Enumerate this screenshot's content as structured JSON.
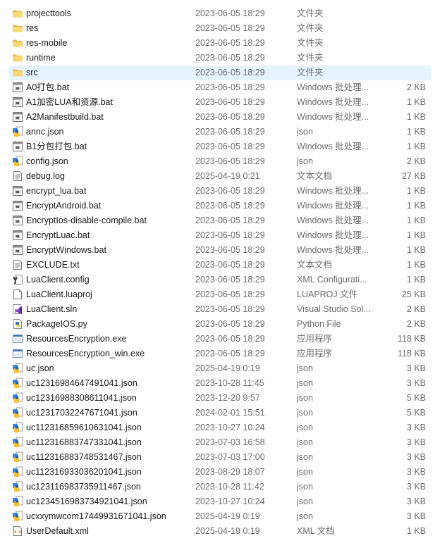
{
  "files": [
    {
      "name": "projecttools",
      "date": "2023-06-05 18:29",
      "type": "文件夹",
      "size": "",
      "icon": "folder-icon"
    },
    {
      "name": "res",
      "date": "2023-06-05 18:29",
      "type": "文件夹",
      "size": "",
      "icon": "folder-icon"
    },
    {
      "name": "res-mobile",
      "date": "2023-06-05 18:29",
      "type": "文件夹",
      "size": "",
      "icon": "folder-icon"
    },
    {
      "name": "runtime",
      "date": "2023-06-05 18:29",
      "type": "文件夹",
      "size": "",
      "icon": "folder-icon"
    },
    {
      "name": "src",
      "date": "2023-06-05 18:29",
      "type": "文件夹",
      "size": "",
      "icon": "folder-icon",
      "selected": true
    },
    {
      "name": "A0打包.bat",
      "date": "2023-06-05 18:29",
      "type": "Windows 批处理...",
      "size": "2 KB",
      "icon": "batch-file-icon"
    },
    {
      "name": "A1加密LUA和资源.bat",
      "date": "2023-06-05 18:29",
      "type": "Windows 批处理...",
      "size": "1 KB",
      "icon": "batch-file-icon"
    },
    {
      "name": "A2Manifestbuild.bat",
      "date": "2023-06-05 18:29",
      "type": "Windows 批处理...",
      "size": "1 KB",
      "icon": "batch-file-icon"
    },
    {
      "name": "annc.json",
      "date": "2023-06-05 18:29",
      "type": "json",
      "size": "1 KB",
      "icon": "json-file-icon"
    },
    {
      "name": "B1分包打包.bat",
      "date": "2023-06-05 18:29",
      "type": "Windows 批处理...",
      "size": "1 KB",
      "icon": "batch-file-icon"
    },
    {
      "name": "config.json",
      "date": "2023-06-05 18:29",
      "type": "json",
      "size": "2 KB",
      "icon": "json-file-icon"
    },
    {
      "name": "debug.log",
      "date": "2025-04-19 0:21",
      "type": "文本文档",
      "size": "27 KB",
      "icon": "text-file-icon"
    },
    {
      "name": "encrypt_lua.bat",
      "date": "2023-06-05 18:29",
      "type": "Windows 批处理...",
      "size": "1 KB",
      "icon": "batch-file-icon"
    },
    {
      "name": "EncryptAndroid.bat",
      "date": "2023-06-05 18:29",
      "type": "Windows 批处理...",
      "size": "1 KB",
      "icon": "batch-file-icon"
    },
    {
      "name": "EncryptIos-disable-compile.bat",
      "date": "2023-06-05 18:29",
      "type": "Windows 批处理...",
      "size": "1 KB",
      "icon": "batch-file-icon"
    },
    {
      "name": "EncryptLuac.bat",
      "date": "2023-06-05 18:29",
      "type": "Windows 批处理...",
      "size": "1 KB",
      "icon": "batch-file-icon"
    },
    {
      "name": "EncryptWindows.bat",
      "date": "2023-06-05 18:29",
      "type": "Windows 批处理...",
      "size": "1 KB",
      "icon": "batch-file-icon"
    },
    {
      "name": "EXCLUDE.txt",
      "date": "2023-06-05 18:29",
      "type": "文本文档",
      "size": "1 KB",
      "icon": "text-file-icon"
    },
    {
      "name": "LuaClient.config",
      "date": "2023-06-05 18:29",
      "type": "XML Configurati...",
      "size": "1 KB",
      "icon": "config-file-icon"
    },
    {
      "name": "LuaClient.luaproj",
      "date": "2023-06-05 18:29",
      "type": "LUAPROJ 文件",
      "size": "25 KB",
      "icon": "blank-file-icon"
    },
    {
      "name": "LuaClient.sln",
      "date": "2023-06-05 18:29",
      "type": "Visual Studio Sol...",
      "size": "2 KB",
      "icon": "visual-studio-solution-icon"
    },
    {
      "name": "PackageIOS.py",
      "date": "2023-06-05 18:29",
      "type": "Python File",
      "size": "2 KB",
      "icon": "python-file-icon"
    },
    {
      "name": "ResourcesEncryption.exe",
      "date": "2023-06-05 18:29",
      "type": "应用程序",
      "size": "118 KB",
      "icon": "application-icon"
    },
    {
      "name": "ResourcesEncryption_win.exe",
      "date": "2023-06-05 18:29",
      "type": "应用程序",
      "size": "118 KB",
      "icon": "application-icon"
    },
    {
      "name": "uc.json",
      "date": "2025-04-19 0:19",
      "type": "json",
      "size": "3 KB",
      "icon": "json-file-icon"
    },
    {
      "name": "uc12316984647491041.json",
      "date": "2023-10-28 11:45",
      "type": "json",
      "size": "3 KB",
      "icon": "json-file-icon"
    },
    {
      "name": "uc12316988308611041.json",
      "date": "2023-12-20 9:57",
      "type": "json",
      "size": "5 KB",
      "icon": "json-file-icon"
    },
    {
      "name": "uc12317032247671041.json",
      "date": "2024-02-01 15:51",
      "type": "json",
      "size": "5 KB",
      "icon": "json-file-icon"
    },
    {
      "name": "uc112316859610631041.json",
      "date": "2023-10-27 10:24",
      "type": "json",
      "size": "3 KB",
      "icon": "json-file-icon"
    },
    {
      "name": "uc112316883747331041.json",
      "date": "2023-07-03 16:58",
      "type": "json",
      "size": "3 KB",
      "icon": "json-file-icon"
    },
    {
      "name": "uc112316883748531467.json",
      "date": "2023-07-03 17:00",
      "type": "json",
      "size": "3 KB",
      "icon": "json-file-icon"
    },
    {
      "name": "uc112316933036201041.json",
      "date": "2023-08-29 18:07",
      "type": "json",
      "size": "3 KB",
      "icon": "json-file-icon"
    },
    {
      "name": "uc123116983735911467.json",
      "date": "2023-10-28 11:42",
      "type": "json",
      "size": "3 KB",
      "icon": "json-file-icon"
    },
    {
      "name": "uc12345169837349210 41.json",
      "date": "2023-10-27 10:24",
      "type": "json",
      "size": "3 KB",
      "icon": "json-file-icon"
    },
    {
      "name": "ucxxymwcom17449931671041.json",
      "date": "2025-04-19 0:19",
      "type": "json",
      "size": "3 KB",
      "icon": "json-file-icon"
    },
    {
      "name": "UserDefault.xml",
      "date": "2025-04-19 0:19",
      "type": "XML 文档",
      "size": "1 KB",
      "icon": "xml-file-icon"
    }
  ]
}
